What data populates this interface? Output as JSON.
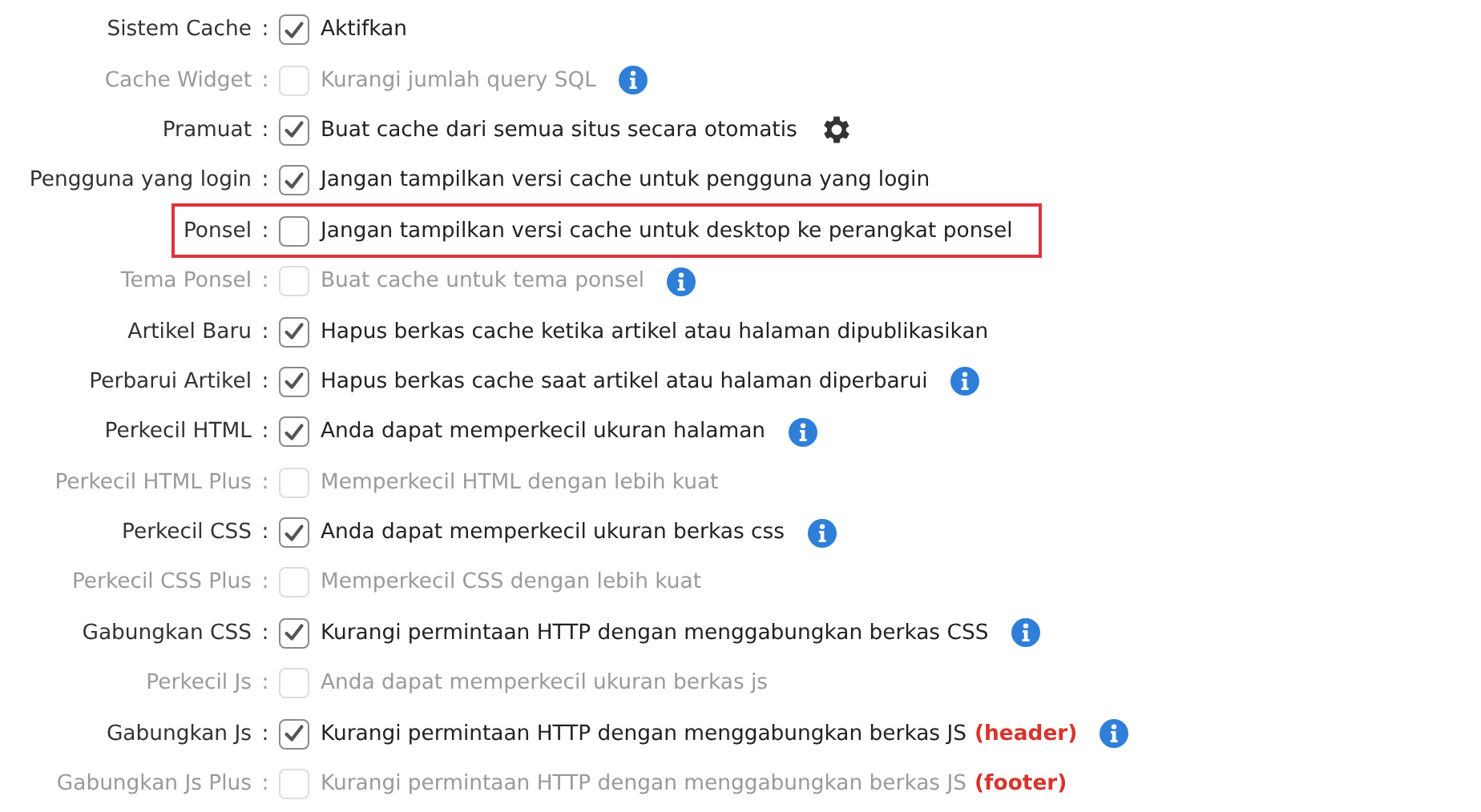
{
  "settings": [
    {
      "label": "Sistem Cache",
      "separator": ":",
      "checked": true,
      "disabled": false,
      "text": "Aktifkan",
      "kind": "plain",
      "highlighted": false
    },
    {
      "label": "Cache Widget",
      "separator": ":",
      "checked": false,
      "disabled": true,
      "text": "Kurangi jumlah query SQL",
      "kind": "info",
      "highlighted": false
    },
    {
      "label": "Pramuat",
      "separator": ":",
      "checked": true,
      "disabled": false,
      "text": "Buat cache dari semua situs secara otomatis",
      "kind": "gear",
      "highlighted": false
    },
    {
      "label": "Pengguna yang login",
      "separator": ":",
      "checked": true,
      "disabled": false,
      "text": "Jangan tampilkan versi cache untuk pengguna yang login",
      "kind": "plain",
      "highlighted": false
    },
    {
      "label": "Ponsel",
      "separator": ":",
      "checked": false,
      "disabled": false,
      "text": "Jangan tampilkan versi cache untuk desktop ke perangkat ponsel",
      "kind": "plain",
      "highlighted": true
    },
    {
      "label": "Tema Ponsel",
      "separator": ":",
      "checked": false,
      "disabled": true,
      "text": "Buat cache untuk tema ponsel",
      "kind": "info",
      "highlighted": false
    },
    {
      "label": "Artikel Baru",
      "separator": ":",
      "checked": true,
      "disabled": false,
      "text": "Hapus berkas cache ketika artikel atau halaman dipublikasikan",
      "kind": "plain",
      "highlighted": false
    },
    {
      "label": "Perbarui Artikel",
      "separator": ":",
      "checked": true,
      "disabled": false,
      "text": "Hapus berkas cache saat artikel atau halaman diperbarui",
      "kind": "info",
      "highlighted": false
    },
    {
      "label": "Perkecil HTML",
      "separator": ":",
      "checked": true,
      "disabled": false,
      "text": "Anda dapat memperkecil ukuran halaman",
      "kind": "info",
      "highlighted": false
    },
    {
      "label": "Perkecil HTML Plus",
      "separator": ":",
      "checked": false,
      "disabled": true,
      "text": "Memperkecil HTML dengan lebih kuat",
      "kind": "plain",
      "highlighted": false
    },
    {
      "label": "Perkecil CSS",
      "separator": ":",
      "checked": true,
      "disabled": false,
      "text": "Anda dapat memperkecil ukuran berkas css",
      "kind": "info",
      "highlighted": false
    },
    {
      "label": "Perkecil CSS Plus",
      "separator": ":",
      "checked": false,
      "disabled": true,
      "text": "Memperkecil CSS dengan lebih kuat",
      "kind": "plain",
      "highlighted": false
    },
    {
      "label": "Gabungkan CSS",
      "separator": ":",
      "checked": true,
      "disabled": false,
      "text": "Kurangi permintaan HTTP dengan menggabungkan berkas CSS",
      "kind": "info",
      "highlighted": false
    },
    {
      "label": "Perkecil Js",
      "separator": ":",
      "checked": false,
      "disabled": true,
      "text": "Anda dapat memperkecil ukuran berkas js",
      "kind": "plain",
      "highlighted": false
    },
    {
      "label": "Gabungkan Js",
      "separator": ":",
      "checked": true,
      "disabled": false,
      "text": "Kurangi permintaan HTTP dengan menggabungkan berkas JS",
      "tag": "(header)",
      "kind": "info",
      "highlighted": false
    },
    {
      "label": "Gabungkan Js Plus",
      "separator": ":",
      "checked": false,
      "disabled": true,
      "text": "Kurangi permintaan HTTP dengan menggabungkan berkas JS",
      "tag": "(footer)",
      "kind": "plain",
      "highlighted": false
    }
  ]
}
